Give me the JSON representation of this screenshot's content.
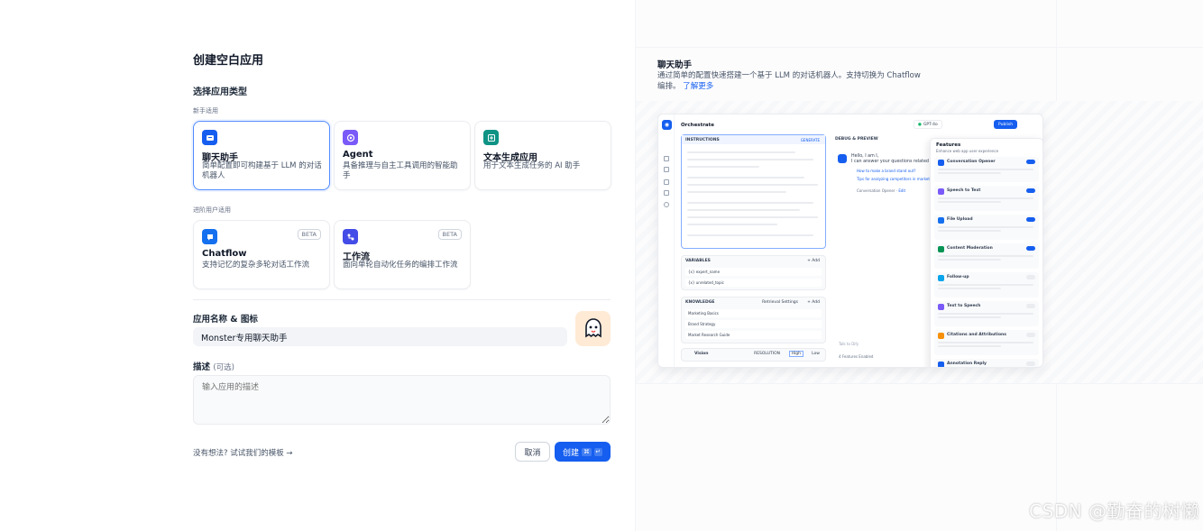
{
  "page": {
    "title": "创建空白应用",
    "section_type": "选择应用类型",
    "group_beginner": "新手适用",
    "group_advanced": "进阶用户适用"
  },
  "app_types": [
    {
      "name": "聊天助手",
      "desc": "简单配置即可构建基于 LLM 的对话机器人",
      "icon": "chat-bubble-icon",
      "color": "#155eef",
      "selected": true
    },
    {
      "name": "Agent",
      "desc": "具备推理与自主工具调用的智能助手",
      "icon": "agent-icon",
      "color": "#7a5af8",
      "selected": false
    },
    {
      "name": "文本生成应用",
      "desc": "用于文本生成任务的 AI 助手",
      "icon": "text-generate-icon",
      "color": "#0e9384",
      "selected": false
    }
  ],
  "advanced_types": [
    {
      "name": "Chatflow",
      "desc": "支持记忆的复杂多轮对话工作流",
      "badge": "BETA",
      "icon": "chatflow-icon",
      "color": "#1570ef"
    },
    {
      "name": "工作流",
      "desc": "面向单轮自动化任务的编排工作流",
      "badge": "BETA",
      "icon": "workflow-icon",
      "color": "#444ce7"
    }
  ],
  "form": {
    "name_label": "应用名称 & 图标",
    "name_value": "Monster专用聊天助手",
    "desc_label": "描述",
    "desc_optional": "(可选)",
    "desc_placeholder": "输入应用的描述"
  },
  "footer": {
    "template_link": "没有想法? 试试我们的模板",
    "cancel": "取消",
    "create": "创建",
    "shortcut_1": "⌘",
    "shortcut_2": "↵"
  },
  "preview": {
    "title": "聊天助手",
    "desc": "通过简单的配置快速搭建一个基于 LLM 的对话机器人。支持切换为 Chatflow 编排。",
    "learn_more": "了解更多",
    "mock": {
      "orchestrate": "Orchestrate",
      "model": "GPT-4o",
      "publish": "Publish",
      "instructions": "INSTRUCTIONS",
      "generate": "GENERATE",
      "variables": "VARIABLES",
      "var_add": "+ Add",
      "var_1": "{x} expert_name",
      "var_2": "{x} unrelated_topic",
      "knowledge": "KNOWLEDGE",
      "retrieval": "Retrieval Settings",
      "kb_1": "Marketing Basics",
      "kb_2": "Brand Strategy",
      "kb_3": "Market Research Guide",
      "vision": "Vision",
      "resolution": "RESOLUTION",
      "high": "High",
      "low": "Low",
      "debug": "DEBUG & PREVIEW",
      "greeting_1": "Hello, I am I,",
      "greeting_2": "I can answer your questions related",
      "q_1": "How to make a brand stand out?",
      "q_2": "Tips for analyzing competitors in market",
      "opener": "Conversation Opener",
      "edit": "Edit",
      "talk": "Talk to Dify",
      "features_enabled": "4 Features Enabled",
      "features": "Features",
      "features_sub": "Enhance web app user experience",
      "feature_list": [
        {
          "name": "Conversation Opener",
          "color": "#155eef",
          "on": true
        },
        {
          "name": "Speech to Text",
          "color": "#7a5af8",
          "on": true
        },
        {
          "name": "File Upload",
          "color": "#1570ef",
          "on": true
        },
        {
          "name": "Content Moderation",
          "color": "#079455",
          "on": true
        },
        {
          "name": "Follow-up",
          "color": "#0ba5ec",
          "on": false
        },
        {
          "name": "Text to Speech",
          "color": "#7a5af8",
          "on": false
        },
        {
          "name": "Citations and Attributions",
          "color": "#f79009",
          "on": false
        },
        {
          "name": "Annotation Reply",
          "color": "#155eef",
          "on": false
        }
      ]
    }
  },
  "watermark": "CSDN @勤奋的树懒"
}
